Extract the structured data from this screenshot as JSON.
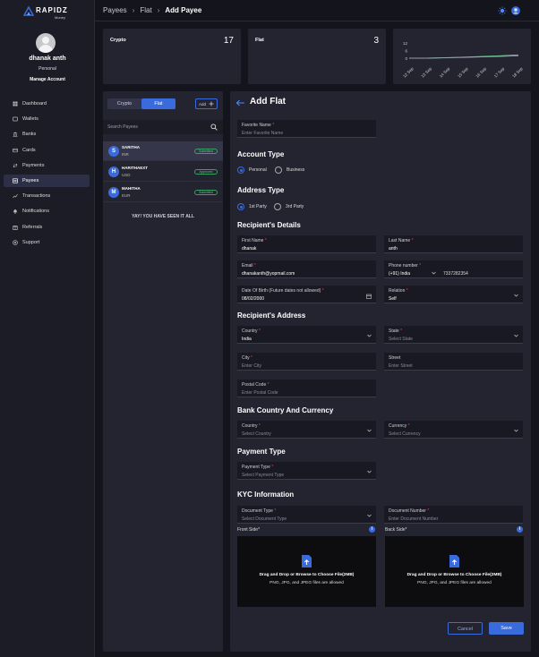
{
  "brand": {
    "name": "RAPIDZ",
    "sub": "Money"
  },
  "user": {
    "name": "dhanak anth",
    "type": "Personal",
    "manage_label": "Manage Account"
  },
  "nav": [
    {
      "label": "Dashboard",
      "icon": "dashboard-icon"
    },
    {
      "label": "Wallets",
      "icon": "wallet-icon"
    },
    {
      "label": "Banks",
      "icon": "bank-icon"
    },
    {
      "label": "Cards",
      "icon": "card-icon"
    },
    {
      "label": "Payments",
      "icon": "payments-icon"
    },
    {
      "label": "Payees",
      "icon": "payees-icon",
      "active": true
    },
    {
      "label": "Transactions",
      "icon": "transactions-icon"
    },
    {
      "label": "Notifications",
      "icon": "bell-icon"
    },
    {
      "label": "Referrals",
      "icon": "referrals-icon"
    },
    {
      "label": "Support",
      "icon": "support-icon"
    }
  ],
  "breadcrumb": [
    "Payees",
    "Flat",
    "Add Payee"
  ],
  "stats": [
    {
      "label": "Crypto",
      "value": "17"
    },
    {
      "label": "Flat",
      "value": "3"
    }
  ],
  "chart_data": {
    "type": "line",
    "categories": [
      "12 Sep",
      "13 Sep",
      "14 Sep",
      "15 Sep",
      "16 Sep",
      "17 Sep",
      "18 Sep"
    ],
    "yticks": [
      "12",
      "6",
      "0"
    ],
    "ylim": [
      0,
      12
    ],
    "series": [
      {
        "values": [
          0,
          0,
          0.4,
          0.8,
          1.4,
          1.9,
          2.6
        ],
        "color": "#5fd08a"
      },
      {
        "values": [
          0,
          0,
          0.3,
          0.6,
          1.0,
          1.4,
          1.9
        ],
        "color": "#9aa0b0"
      }
    ]
  },
  "payees": {
    "tabs": [
      "Crypto",
      "Flat"
    ],
    "active_tab": "Flat",
    "add_label": "Add",
    "search_placeholder": "Search Payees",
    "items": [
      {
        "initial": "S",
        "name": "SARITHA",
        "currency": "INR",
        "status": "Submitted"
      },
      {
        "initial": "H",
        "name": "HARITHAEXT",
        "currency": "USD",
        "status": "Approved"
      },
      {
        "initial": "M",
        "name": "MAHITHA",
        "currency": "EUR",
        "status": "Submitted"
      }
    ],
    "end_text": "YAY! YOU HAVE SEEN IT ALL"
  },
  "form": {
    "title": "Add Flat",
    "favorite": {
      "label": "Favorite Name",
      "placeholder": "Enter Favorite Name"
    },
    "account_type": {
      "title": "Account Type",
      "options": [
        "Personal",
        "Business"
      ],
      "selected": "Personal"
    },
    "address_type": {
      "title": "Address Type",
      "options": [
        "1st Party",
        "3rd Party"
      ],
      "selected": "1st Party"
    },
    "recipient_details": {
      "title": "Recipient's Details",
      "first_name": {
        "label": "First Name",
        "value": "dhanak"
      },
      "last_name": {
        "label": "Last Name",
        "value": "anth"
      },
      "email": {
        "label": "Email",
        "value": "dhanakanth@yopmail.com"
      },
      "phone": {
        "label": "Phone number",
        "code": "(+91) India",
        "value": "7337282354"
      },
      "dob": {
        "label": "Date Of Birth (Future dates not allowed)",
        "value": "08/02/2000"
      },
      "relation": {
        "label": "Relation",
        "value": "Self"
      }
    },
    "recipient_address": {
      "title": "Recipient's Address",
      "country": {
        "label": "Country",
        "value": "India"
      },
      "state": {
        "label": "State",
        "placeholder": "Select State"
      },
      "city": {
        "label": "City",
        "placeholder": "Enter City"
      },
      "street": {
        "label": "Street",
        "placeholder": "Enter Street"
      },
      "postal": {
        "label": "Postal Code",
        "placeholder": "Enter Postal Code"
      }
    },
    "bank": {
      "title": "Bank Country And Currency",
      "country": {
        "label": "Country",
        "placeholder": "Select Country"
      },
      "currency": {
        "label": "Currency",
        "placeholder": "Select Currency"
      }
    },
    "payment": {
      "title": "Payment Type",
      "type": {
        "label": "Payment Type",
        "placeholder": "Select Payment Type"
      }
    },
    "kyc": {
      "title": "KYC Information",
      "doc_type": {
        "label": "Document Type",
        "placeholder": "Select Document Type"
      },
      "doc_number": {
        "label": "Document Number",
        "placeholder": "Enter Document Number"
      },
      "front_label": "Front Side*",
      "back_label": "Back Side*",
      "drop_text": "Drag and Drop or Browse to Choose File(2MB)",
      "drop_hint": "PNG, JPG, and JPEG files are allowed"
    },
    "cancel_label": "Cancel",
    "save_label": "Save"
  },
  "colors": {
    "accent": "#3a6bdc",
    "background": "#14151c",
    "panel": "#23242f",
    "success": "#5fcc88",
    "required": "#e0455a"
  }
}
